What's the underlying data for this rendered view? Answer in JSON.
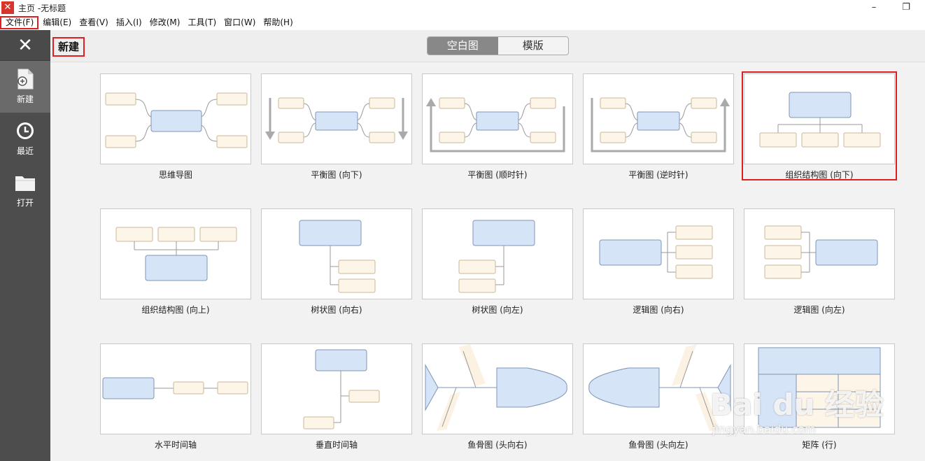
{
  "window": {
    "title": "主页 -无标题"
  },
  "menu": [
    "文件(F)",
    "编辑(E)",
    "查看(V)",
    "插入(I)",
    "修改(M)",
    "工具(T)",
    "窗口(W)",
    "帮助(H)"
  ],
  "sidebar": {
    "items": [
      {
        "label": "新建",
        "icon": "new-file-icon"
      },
      {
        "label": "最近",
        "icon": "clock-icon"
      },
      {
        "label": "打开",
        "icon": "folder-icon"
      }
    ]
  },
  "header": {
    "title": "新建",
    "tabs": [
      "空白图",
      "模版"
    ]
  },
  "templates": [
    "思维导图",
    "平衡图 (向下)",
    "平衡图 (顺时针)",
    "平衡图 (逆时针)",
    "组织结构图 (向下)",
    "组织结构图 (向上)",
    "树状图 (向右)",
    "树状图 (向左)",
    "逻辑图 (向右)",
    "逻辑图 (向左)",
    "水平时间轴",
    "垂直时间轴",
    "鱼骨图 (头向右)",
    "鱼骨图 (头向左)",
    "矩阵 (行)"
  ],
  "watermark": {
    "main": "Bai du 经验",
    "sub": "jingyan.baidu.com"
  },
  "colors": {
    "node_fill": "#d6e4f8",
    "node_stroke": "#7f94b5",
    "leaf_fill": "#fdf5e8",
    "leaf_stroke": "#c9b89a",
    "selection": "#e02020"
  }
}
